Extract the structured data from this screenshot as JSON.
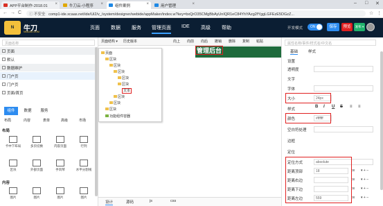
{
  "browser": {
    "tabs": [
      {
        "label": "APP平台制作-2018.01",
        "color": "#d93025"
      },
      {
        "label": "牛刀云-小程序",
        "color": "#e0a800"
      },
      {
        "label": "组件案例",
        "color": "#1e88e5"
      },
      {
        "label": "用户管理",
        "color": "#1e88e5"
      }
    ],
    "window_controls": [
      "–",
      "□",
      "✕"
    ],
    "nav": [
      "←",
      "→",
      "C"
    ],
    "url_prefix": "ⓘ 不安全",
    "url": "comp1-ide.xcaas.net/ide/Ui2/v_/system/designer/webide/appMaker/index.w?key=bxQrO35CMgBbAyUnIQR1eC84YhYAzg2fYggLGFEzE5DGzZ..."
  },
  "app": {
    "logo_text": "N",
    "brand": "牛刀",
    "brand_sub": "NIUDAO.COM",
    "menu": [
      "页面",
      "数据",
      "服务",
      "管理页面",
      "IDE",
      "高级",
      "帮助"
    ],
    "menu_active": "管理页面",
    "dev_mode_label": "开发模式",
    "toggle_label": "ON",
    "save_label": "保存",
    "preview_label": "预览",
    "more_label": "发布 ▾",
    "accent": "#2d8cf0",
    "bg": "#0b1e33"
  },
  "left": {
    "search_placeholder": "页面名称",
    "rows": [
      {
        "label": "页面",
        "sect": true
      },
      {
        "label": "默认",
        "sect": false
      },
      {
        "label": "数据维护",
        "sect": true
      },
      {
        "label": "门户页",
        "sect": false
      },
      {
        "label": "门户页",
        "sect": false
      },
      {
        "label": "页面/首页",
        "sect": false
      }
    ],
    "tabs": [
      "组件",
      "数据",
      "服务"
    ],
    "subtabs": [
      "布局",
      "内容",
      "表单",
      "高级",
      "市场"
    ],
    "cat_layout": "布局",
    "layout_comps": [
      "卡中下布局",
      "多页切换",
      "内容页面",
      "行列",
      "区块",
      "外部页面",
      "手风琴",
      "水平分割线"
    ],
    "cat_content": "内容",
    "content_comps": [
      "图片",
      "图片",
      "图片",
      "图片"
    ]
  },
  "canvas": {
    "toolbar": [
      "页面结构 ▾",
      "历史版本",
      "向上",
      "向前",
      "向后",
      "撤销",
      "删除",
      "复制",
      "粘贴"
    ],
    "title": "管理后台",
    "tree": [
      {
        "label": "页面",
        "indent": 0
      },
      {
        "label": "区块",
        "indent": 1
      },
      {
        "label": "区块",
        "indent": 2
      },
      {
        "label": "区块",
        "indent": 3
      },
      {
        "label": "区块",
        "indent": 4
      },
      {
        "label": "区块",
        "indent": 4
      },
      {
        "label": "文本",
        "indent": 5,
        "selected": true
      },
      {
        "label": "区块",
        "indent": 3
      },
      {
        "label": "区块",
        "indent": 2
      },
      {
        "label": "区块",
        "indent": 1
      },
      {
        "label": "功能组件容器",
        "indent": 1
      }
    ],
    "bottom_tabs": [
      "设计",
      "源码",
      "js",
      "css"
    ]
  },
  "right": {
    "search_placeholder": "属性名称/事件/样式名/中文名",
    "tabs": [
      "基础",
      "样式"
    ],
    "props": [
      {
        "label": "设置",
        "value": ""
      },
      {
        "label": "透明度",
        "value": ""
      },
      {
        "label": "文字",
        "value": ""
      },
      {
        "label": "字体",
        "value": ""
      },
      {
        "label": "大小",
        "value": "24px"
      },
      {
        "label": "样式",
        "value": ""
      },
      {
        "label": "颜色",
        "value": "#ffffff"
      },
      {
        "label": "空白符处理",
        "value": ""
      },
      {
        "label": "边框",
        "value": ""
      },
      {
        "label": "定位",
        "value": ""
      },
      {
        "label": "定位方式",
        "value": "absolute"
      },
      {
        "label": "距离顶部",
        "value": "18"
      },
      {
        "label": "距离右边",
        "value": ""
      },
      {
        "label": "距离下边",
        "value": ""
      },
      {
        "label": "距离左边",
        "value": "559"
      }
    ],
    "unit": "px",
    "font_buttons": [
      "B",
      "I",
      "U",
      "S",
      "≡",
      "≡"
    ]
  }
}
